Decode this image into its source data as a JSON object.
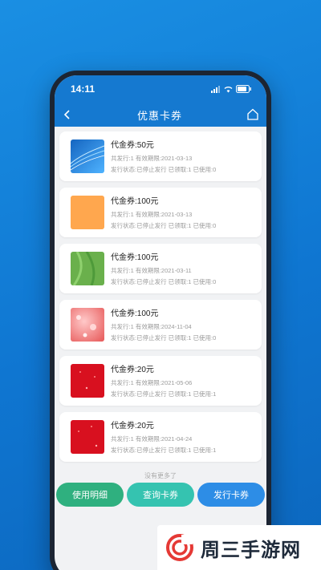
{
  "status": {
    "time": "14:11"
  },
  "nav": {
    "title": "优惠卡券"
  },
  "coupons": [
    {
      "title": "代金券:50元",
      "line1": "共发行:1  有效期限:2021-03-13",
      "line2": "发行状态:已停止发行   已领取:1   已使用:0",
      "thumb": "blue-wave"
    },
    {
      "title": "代金券:100元",
      "line1": "共发行:1  有效期限:2021-03-13",
      "line2": "发行状态:已停止发行   已领取:1   已使用:0",
      "thumb": "orange"
    },
    {
      "title": "代金券:100元",
      "line1": "共发行:1  有效期限:2021-03-11",
      "line2": "发行状态:已停止发行   已领取:1   已使用:0",
      "thumb": "green"
    },
    {
      "title": "代金券:100元",
      "line1": "共发行:1  有效期限:2024-11-04",
      "line2": "发行状态:已停止发行   已领取:1   已使用:0",
      "thumb": "pink"
    },
    {
      "title": "代金券:20元",
      "line1": "共发行:1  有效期限:2021-05-06",
      "line2": "发行状态:已停止发行   已领取:1   已使用:1",
      "thumb": "red"
    },
    {
      "title": "代金券:20元",
      "line1": "共发行:1  有效期限:2021-04-24",
      "line2": "发行状态:已停止发行   已领取:1   已使用:1",
      "thumb": "red"
    }
  ],
  "no_more": "没有更多了",
  "buttons": {
    "details": "使用明细",
    "query": "查询卡券",
    "issue": "发行卡券"
  },
  "watermark": {
    "text": "周三手游网"
  },
  "colors": {
    "brand_blue": "#1579d0",
    "green": "#2fb07f",
    "teal": "#35c3b0",
    "blue_button": "#2d8de6"
  },
  "icons": {
    "back": "chevron-left-icon",
    "home": "home-icon",
    "wifi": "wifi-icon",
    "signal": "signal-icon",
    "battery": "battery-icon"
  }
}
